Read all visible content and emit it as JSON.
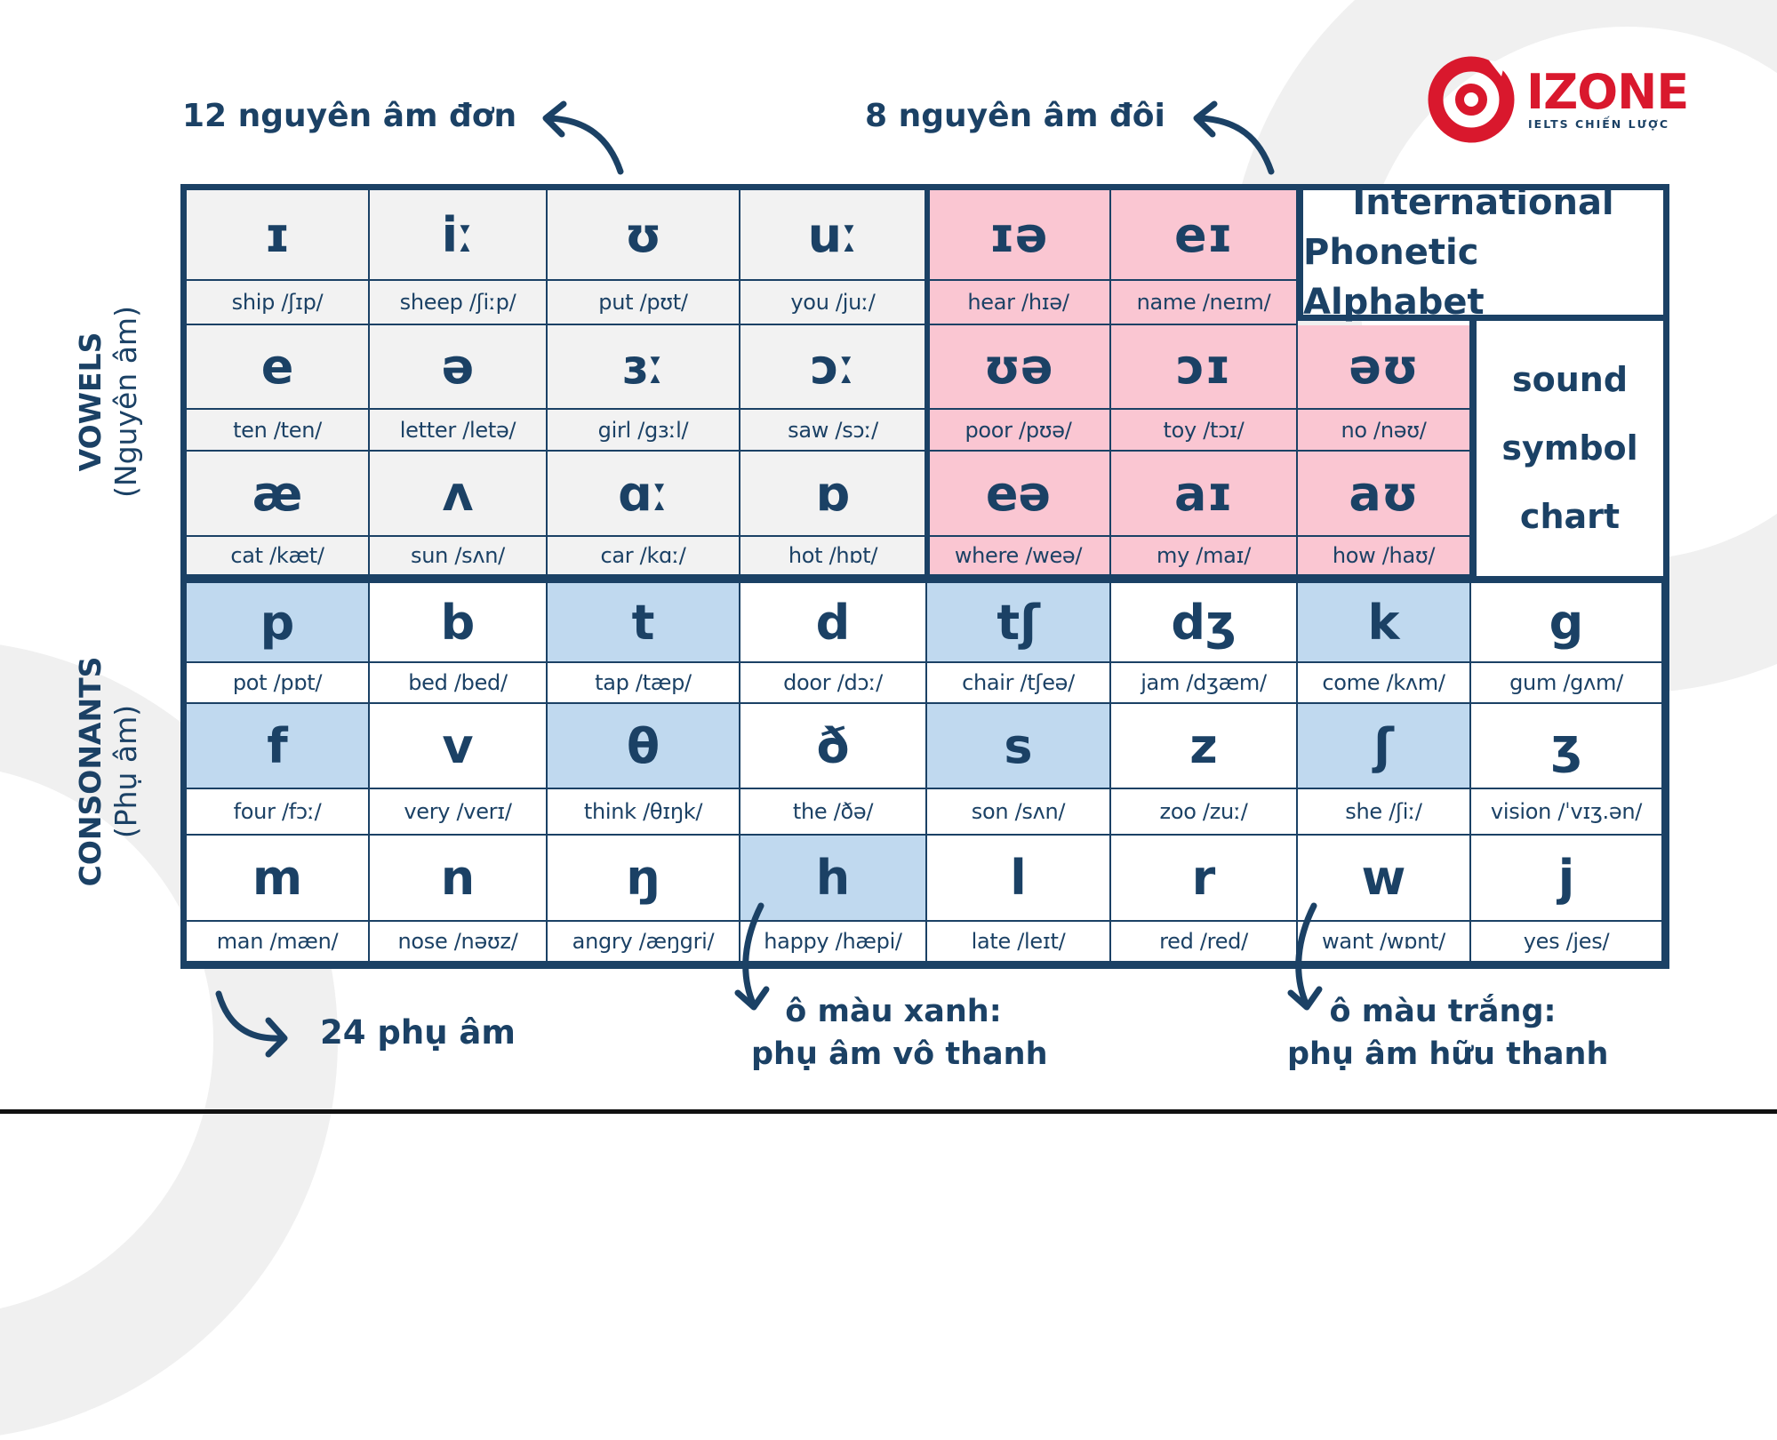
{
  "brand": {
    "name": "IZONE",
    "tagline": "IELTS CHIẾN LƯỢC",
    "colors": {
      "red": "#d9182d",
      "navy": "#1b4165"
    }
  },
  "annotations": {
    "monophthongs": "12 nguyên âm đơn",
    "diphthongs": "8 nguyên âm đôi",
    "consonants_count": "24 phụ âm",
    "blue_note_line1": "ô màu xanh:",
    "blue_note_line2": "phụ âm vô thanh",
    "white_note_line1": "ô màu trắng:",
    "white_note_line2": "phụ âm hữu thanh"
  },
  "side_labels": {
    "vowels_en": "VOWELS",
    "vowels_vi": "(Nguyên âm)",
    "consonants_en": "CONSONANTS",
    "consonants_vi": "(Phụ âm)"
  },
  "title_box": {
    "line1": "International",
    "line2": "Phonetic Alphabet"
  },
  "subtitle_box": {
    "line1": "sound",
    "line2": "symbol",
    "line3": "chart"
  },
  "colors": {
    "monophthong_cell": "#f2f2f2",
    "diphthong_cell": "#fac6d2",
    "voiceless_cell": "#c0d9ef",
    "voiced_cell": "#ffffff",
    "border": "#1b4165"
  },
  "vowels": {
    "monophthongs": [
      [
        {
          "symbol": "ɪ",
          "example": "ship /ʃɪp/"
        },
        {
          "symbol": "iː",
          "example": "sheep /ʃiːp/"
        },
        {
          "symbol": "ʊ",
          "example": "put /pʊt/"
        },
        {
          "symbol": "uː",
          "example": "you /juː/"
        }
      ],
      [
        {
          "symbol": "e",
          "example": "ten /ten/"
        },
        {
          "symbol": "ə",
          "example": "letter /letə/"
        },
        {
          "symbol": "ɜː",
          "example": "girl /gɜːl/"
        },
        {
          "symbol": "ɔː",
          "example": "saw /sɔː/"
        }
      ],
      [
        {
          "symbol": "æ",
          "example": "cat /kæt/"
        },
        {
          "symbol": "ʌ",
          "example": "sun /sʌn/"
        },
        {
          "symbol": "ɑː",
          "example": "car /kɑː/"
        },
        {
          "symbol": "ɒ",
          "example": "hot /hɒt/"
        }
      ]
    ],
    "diphthongs": [
      [
        {
          "symbol": "ɪə",
          "example": "hear /hɪə/"
        },
        {
          "symbol": "eɪ",
          "example": "name /neɪm/"
        }
      ],
      [
        {
          "symbol": "ʊə",
          "example": "poor /pʊə/"
        },
        {
          "symbol": "ɔɪ",
          "example": "toy /tɔɪ/"
        },
        {
          "symbol": "əʊ",
          "example": "no /nəʊ/"
        }
      ],
      [
        {
          "symbol": "eə",
          "example": "where /weə/"
        },
        {
          "symbol": "aɪ",
          "example": "my /maɪ/"
        },
        {
          "symbol": "aʊ",
          "example": "how /haʊ/"
        }
      ]
    ]
  },
  "consonants": [
    [
      {
        "symbol": "p",
        "example": "pot /pɒt/",
        "voiced": false
      },
      {
        "symbol": "b",
        "example": "bed /bed/",
        "voiced": true
      },
      {
        "symbol": "t",
        "example": "tap /tæp/",
        "voiced": false
      },
      {
        "symbol": "d",
        "example": "door /dɔː/",
        "voiced": true
      },
      {
        "symbol": "tʃ",
        "example": "chair /tʃeə/",
        "voiced": false
      },
      {
        "symbol": "dʒ",
        "example": "jam /dʒæm/",
        "voiced": true
      },
      {
        "symbol": "k",
        "example": "come /kʌm/",
        "voiced": false
      },
      {
        "symbol": "g",
        "example": "gum /gʌm/",
        "voiced": true
      }
    ],
    [
      {
        "symbol": "f",
        "example": "four  /fɔː/",
        "voiced": false
      },
      {
        "symbol": "v",
        "example": "very /verɪ/",
        "voiced": true
      },
      {
        "symbol": "θ",
        "example": "think /θɪŋk/",
        "voiced": false
      },
      {
        "symbol": "ð",
        "example": "the /ðə/",
        "voiced": true
      },
      {
        "symbol": "s",
        "example": "son /sʌn/",
        "voiced": false
      },
      {
        "symbol": "z",
        "example": "zoo /zuː/",
        "voiced": true
      },
      {
        "symbol": "ʃ",
        "example": "she /ʃiː/",
        "voiced": false
      },
      {
        "symbol": "ʒ",
        "example": "vision /ˈvɪʒ.ən/",
        "voiced": true
      }
    ],
    [
      {
        "symbol": "m",
        "example": "man /mæn/",
        "voiced": true
      },
      {
        "symbol": "n",
        "example": "nose /nəʊz/",
        "voiced": true
      },
      {
        "symbol": "ŋ",
        "example": "angry  /æŋgri/",
        "voiced": true
      },
      {
        "symbol": "h",
        "example": "happy  /hæpi/",
        "voiced": false
      },
      {
        "symbol": "l",
        "example": "late /leɪt/",
        "voiced": true
      },
      {
        "symbol": "r",
        "example": "red /red/",
        "voiced": true
      },
      {
        "symbol": "w",
        "example": "want /wɒnt/",
        "voiced": true
      },
      {
        "symbol": "j",
        "example": "yes  /jes/",
        "voiced": true
      }
    ]
  ]
}
